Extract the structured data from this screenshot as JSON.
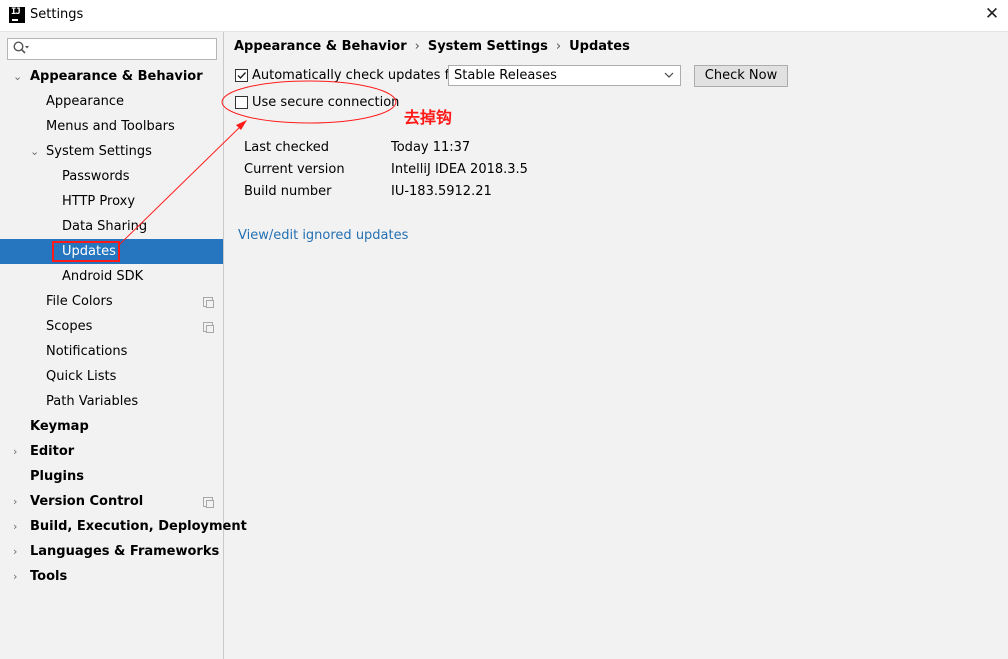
{
  "window": {
    "icon_text": "IJ",
    "title": "Settings",
    "close_glyph": "✕"
  },
  "search": {
    "placeholder": ""
  },
  "sidebar": {
    "items": [
      {
        "label": "Appearance & Behavior",
        "expanded": true,
        "level": 0
      },
      {
        "label": "Appearance",
        "level": 1
      },
      {
        "label": "Menus and Toolbars",
        "level": 1
      },
      {
        "label": "System Settings",
        "expanded": true,
        "level": 1
      },
      {
        "label": "Passwords",
        "level": 2
      },
      {
        "label": "HTTP Proxy",
        "level": 2
      },
      {
        "label": "Data Sharing",
        "level": 2
      },
      {
        "label": "Updates",
        "level": 2,
        "selected": true
      },
      {
        "label": "Android SDK",
        "level": 2
      },
      {
        "label": "File Colors",
        "level": 1,
        "project_icon": true
      },
      {
        "label": "Scopes",
        "level": 1,
        "project_icon": true
      },
      {
        "label": "Notifications",
        "level": 1
      },
      {
        "label": "Quick Lists",
        "level": 1
      },
      {
        "label": "Path Variables",
        "level": 1
      },
      {
        "label": "Keymap",
        "level": 0
      },
      {
        "label": "Editor",
        "level": 0,
        "expanded": false
      },
      {
        "label": "Plugins",
        "level": 0
      },
      {
        "label": "Version Control",
        "level": 0,
        "expanded": false,
        "project_icon": true
      },
      {
        "label": "Build, Execution, Deployment",
        "level": 0,
        "expanded": false
      },
      {
        "label": "Languages & Frameworks",
        "level": 0,
        "expanded": false
      },
      {
        "label": "Tools",
        "level": 0,
        "expanded": false
      }
    ]
  },
  "breadcrumb": {
    "parts": [
      "Appearance & Behavior",
      "System Settings",
      "Updates"
    ],
    "separator": "›"
  },
  "updates": {
    "auto_check_label": "Automatically check updates for",
    "auto_check_checked": true,
    "channel_selected": "Stable Releases",
    "check_now_label": "Check Now",
    "secure_label": "Use secure connection",
    "secure_checked": false,
    "last_checked_label": "Last checked",
    "last_checked_value": "Today 11:37",
    "current_version_label": "Current version",
    "current_version_value": "IntelliJ IDEA 2018.3.5",
    "build_number_label": "Build number",
    "build_number_value": "IU-183.5912.21",
    "ignored_link": "View/edit ignored updates"
  },
  "annotation": {
    "text": "去掉钩",
    "color": "#ff1a1a"
  },
  "colors": {
    "selection": "#2675bf",
    "link": "#2470b3",
    "background": "#f2f2f2"
  }
}
